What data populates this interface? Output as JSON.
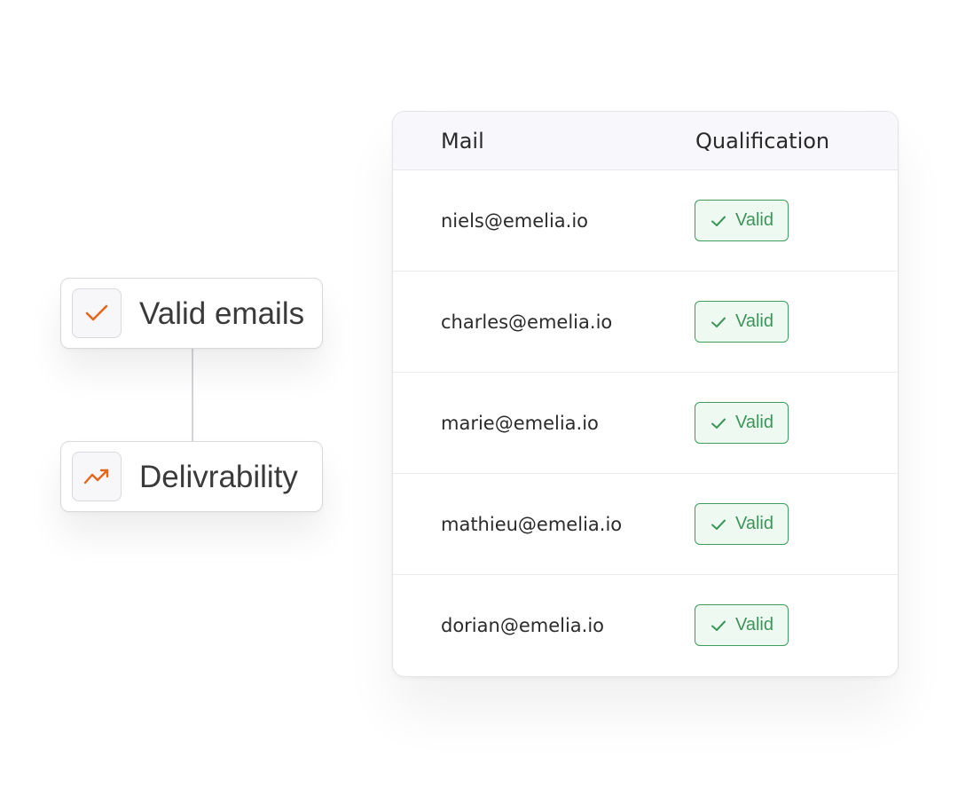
{
  "features": [
    {
      "label": "Valid emails",
      "icon": "checkmark-icon"
    },
    {
      "label": "Delivrability",
      "icon": "trending-up-icon"
    }
  ],
  "colors": {
    "accent_orange": "#e8651a",
    "valid_green": "#3f9c5b",
    "valid_bg": "#eefaf1",
    "header_bg": "#f8f8fc"
  },
  "table": {
    "columns": [
      "Mail",
      "Qualification"
    ],
    "rows": [
      {
        "email": "niels@emelia.io",
        "status": "Valid"
      },
      {
        "email": "charles@emelia.io",
        "status": "Valid"
      },
      {
        "email": "marie@emelia.io",
        "status": "Valid"
      },
      {
        "email": "mathieu@emelia.io",
        "status": "Valid"
      },
      {
        "email": "dorian@emelia.io",
        "status": "Valid"
      }
    ]
  }
}
